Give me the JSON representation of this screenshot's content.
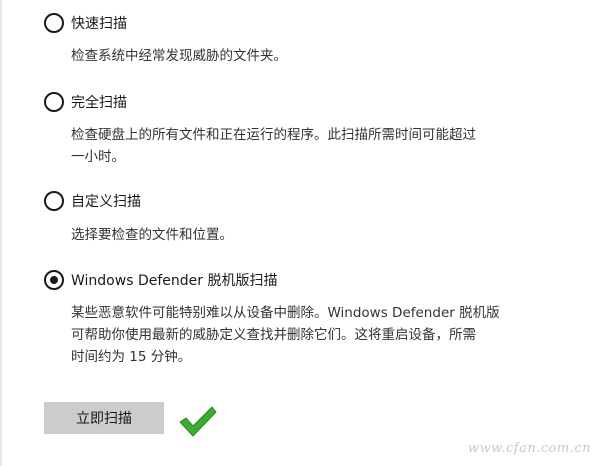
{
  "scan_options": [
    {
      "label": "快速扫描",
      "selected": false,
      "description_lines": [
        "检查系统中经常发现威胁的文件夹。"
      ]
    },
    {
      "label": "完全扫描",
      "selected": false,
      "description_lines": [
        "检查硬盘上的所有文件和正在运行的程序。此扫描所需时间可能超过",
        "一小时。"
      ]
    },
    {
      "label": "自定义扫描",
      "selected": false,
      "description_lines": [
        "选择要检查的文件和位置。"
      ]
    },
    {
      "label": "Windows Defender 脱机版扫描",
      "selected": true,
      "description_lines": [
        "某些恶意软件可能特别难以从设备中删除。Windows Defender 脱机版",
        "可帮助你使用最新的威胁定义查找并删除它们。这将重启设备，所需",
        "时间约为 15 分钟。"
      ]
    }
  ],
  "scan_button_label": "立即扫描",
  "watermark": "www.cfan.com.cn",
  "colors": {
    "checkmark": "#3cab2f",
    "button_bg": "#cccccc",
    "text": "#1a1a1a"
  },
  "icons": {
    "annotation": "green-checkmark-icon"
  }
}
